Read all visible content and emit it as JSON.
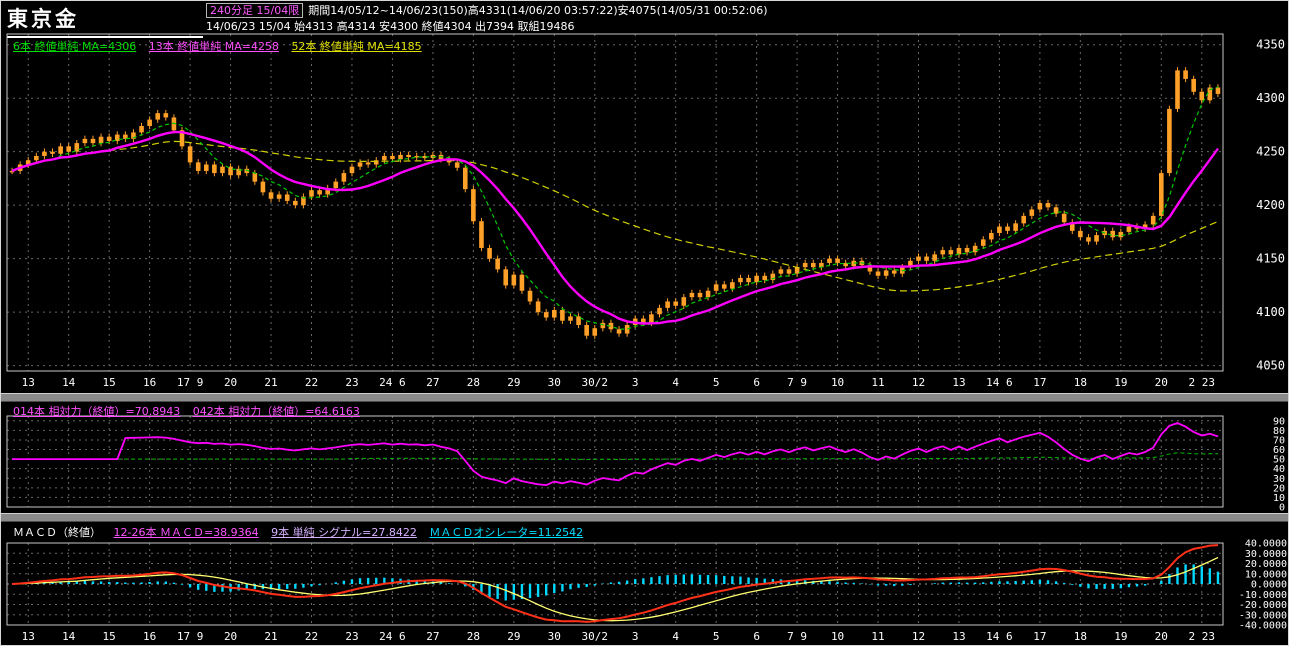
{
  "window": {
    "title": "東京金"
  },
  "header": {
    "period_box": "240分足 15/04限",
    "range_info": "期間14/05/12~14/06/23(150)高4331(14/06/20 03:57:22)安4075(14/05/31 00:52:06)",
    "quote_line": "14/06/23 15/04 始4313 高4314 安4300 終値4304 出7394 取組19486"
  },
  "main_legend": [
    {
      "label": "6本 終値単純 MA=4306",
      "color": "#00e000"
    },
    {
      "label": "13本 終値単純 MA=4258",
      "color": "#ff50ff"
    },
    {
      "label": "52本 終値単純 MA=4185",
      "color": "#e0e000"
    }
  ],
  "rsi_legend": [
    {
      "label": "014本 相対力（終値）=70.8943",
      "color": "#ff50ff"
    },
    {
      "label": "042本 相対力（終値）=64.6163",
      "color": "#ff50ff"
    }
  ],
  "macd_legend": {
    "title": "ＭＡＣＤ（終値）",
    "macd": {
      "label": "12-26本 ＭＡＣＤ=38.9364",
      "color": "#ff55ff"
    },
    "signal": {
      "label": "9本 単純 シグナル=27.8422",
      "color": "#d8b0ff"
    },
    "osc": {
      "label": "ＭＡＣＤオシレータ=11.2542",
      "color": "#00e0ff"
    }
  },
  "colors": {
    "bg": "#000000",
    "frame": "#c8c8c8",
    "grid": "#676767",
    "candle": "#ffa028",
    "text": "#ffffff",
    "separator": "#8a8a8a",
    "ma6": "#00c800",
    "ma13": "#ff00ff",
    "ma52": "#d2d200",
    "rsi_fast": "#ff00ff",
    "rsi_slow": "#00a800",
    "macd_line": "#ff3018",
    "signal_line": "#ffff70",
    "histogram": "#00d8ff"
  },
  "chart_data": [
    {
      "type": "candlestick",
      "title": "東京金 240分足 15/04限",
      "ylim": [
        4045,
        4360
      ],
      "y_ticks": [
        4350,
        4300,
        4250,
        4200,
        4150,
        4100,
        4050
      ],
      "x_labels": [
        "13",
        "14",
        "15",
        "16",
        "17 9",
        "20",
        "21",
        "22",
        "23",
        "24 6",
        "27",
        "28",
        "29",
        "30",
        "30/2",
        "3",
        "4",
        "5",
        "6",
        "7 9",
        "10",
        "11",
        "12",
        "13",
        "14 6",
        "17",
        "18",
        "19",
        "20",
        "2 23"
      ],
      "bars_per_label": 5,
      "closes": [
        4232,
        4238,
        4242,
        4246,
        4250,
        4248,
        4255,
        4250,
        4258,
        4262,
        4258,
        4264,
        4260,
        4266,
        4262,
        4268,
        4274,
        4280,
        4286,
        4282,
        4270,
        4255,
        4240,
        4232,
        4238,
        4230,
        4236,
        4228,
        4234,
        4230,
        4222,
        4212,
        4206,
        4210,
        4204,
        4200,
        4208,
        4214,
        4210,
        4216,
        4222,
        4230,
        4236,
        4240,
        4238,
        4242,
        4246,
        4243,
        4247,
        4245,
        4246,
        4244,
        4247,
        4243,
        4240,
        4235,
        4215,
        4185,
        4160,
        4150,
        4140,
        4125,
        4135,
        4120,
        4110,
        4100,
        4095,
        4102,
        4092,
        4096,
        4088,
        4078,
        4085,
        4090,
        4084,
        4080,
        4088,
        4094,
        4090,
        4098,
        4104,
        4110,
        4106,
        4114,
        4118,
        4114,
        4120,
        4126,
        4122,
        4128,
        4132,
        4128,
        4134,
        4130,
        4136,
        4140,
        4136,
        4142,
        4146,
        4142,
        4146,
        4150,
        4146,
        4143,
        4148,
        4144,
        4138,
        4134,
        4139,
        4136,
        4142,
        4148,
        4152,
        4148,
        4154,
        4158,
        4154,
        4160,
        4156,
        4162,
        4168,
        4174,
        4180,
        4176,
        4183,
        4190,
        4196,
        4202,
        4198,
        4192,
        4184,
        4176,
        4170,
        4166,
        4172,
        4176,
        4170,
        4175,
        4180,
        4178,
        4182,
        4190,
        4230,
        4290,
        4326,
        4318,
        4306,
        4298,
        4310,
        4304
      ],
      "overlays": [
        {
          "name": "6本 終値単純移動平均",
          "period": 6,
          "value": 4306
        },
        {
          "name": "13本 終値単純移動平均",
          "period": 13,
          "value": 4258
        },
        {
          "name": "52本 終値単純移動平均",
          "period": 52,
          "value": 4185
        }
      ],
      "high": {
        "value": 4331,
        "time": "14/06/20 03:57:22"
      },
      "low": {
        "value": 4075,
        "time": "14/05/31 00:52:06"
      }
    },
    {
      "type": "line",
      "name": "相対力（RSI）",
      "ylim": [
        0,
        95
      ],
      "y_ticks": [
        90,
        80,
        70,
        60,
        50,
        40,
        30,
        20,
        10,
        0
      ],
      "series": [
        {
          "name": "014本 相対力（終値）",
          "period": 14,
          "last": 70.8943
        },
        {
          "name": "042本 相対力（終値）",
          "period": 42,
          "last": 64.6163
        }
      ]
    },
    {
      "type": "macd",
      "name": "ＭＡＣＤ（終値）",
      "ylim": [
        -40,
        40
      ],
      "y_tick_labels": [
        "40.0000",
        "30.0000",
        "20.0000",
        "10.0000",
        "0.0000",
        "-10.0000",
        "-20.0000",
        "-30.0000",
        "-40.0000"
      ],
      "fast": 12,
      "slow": 26,
      "signal_period": 9,
      "last": {
        "macd": 38.9364,
        "signal": 27.8422,
        "oscillator": 11.2542
      }
    }
  ]
}
